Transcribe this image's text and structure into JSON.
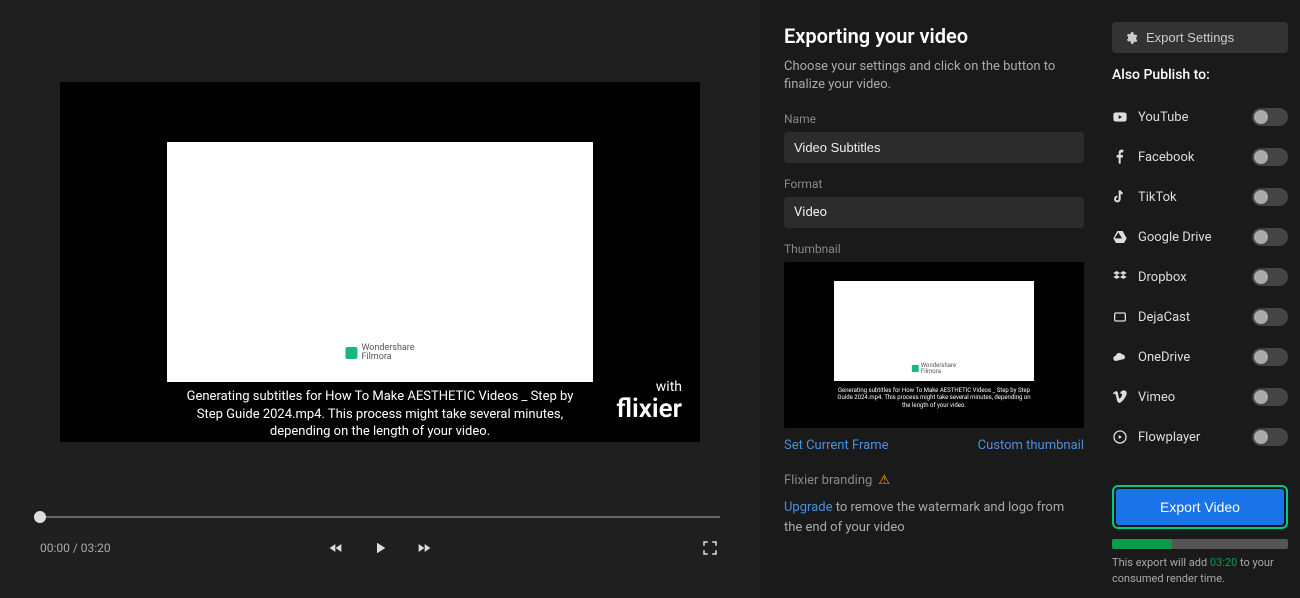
{
  "player": {
    "subtitle_line1": "Generating subtitles for How To Make AESTHETIC Videos _ Step by",
    "subtitle_line2": "Step Guide 2024.mp4. This process might take several minutes,",
    "subtitle_line3": "depending on the length of your video.",
    "watermark_label": "Wondershare\nFilmora",
    "brand_with": "with",
    "brand_name": "flixier",
    "time_display": "00:00 / 03:20"
  },
  "export": {
    "title": "Exporting your video",
    "description": "Choose your settings and click on the button to finalize your video.",
    "name_label": "Name",
    "name_value": "Video Subtitles",
    "format_label": "Format",
    "format_value": "Video",
    "thumb_label": "Thumbnail",
    "thumb_sub_text": "Generating subtitles for How To Make AESTHETIC Videos _ Step by Step Guide 2024.mp4. This process might take several minutes, depending on the length of your video.",
    "set_frame_link": "Set Current Frame",
    "custom_thumb_link": "Custom thumbnail",
    "branding_label": "Flixier branding",
    "upgrade_link": "Upgrade",
    "upgrade_rest": " to remove the watermark and logo from the end of your video"
  },
  "settings_btn": "Export Settings",
  "publish": {
    "also_label": "Also Publish to:",
    "targets": [
      {
        "name": "YouTube"
      },
      {
        "name": "Facebook"
      },
      {
        "name": "TikTok"
      },
      {
        "name": "Google Drive"
      },
      {
        "name": "Dropbox"
      },
      {
        "name": "DejaCast"
      },
      {
        "name": "OneDrive"
      },
      {
        "name": "Vimeo"
      },
      {
        "name": "Flowplayer"
      }
    ]
  },
  "export_btn": "Export Video",
  "export_note_prefix": "This export will add ",
  "export_note_time": "03:20",
  "export_note_suffix": " to your consumed render time."
}
